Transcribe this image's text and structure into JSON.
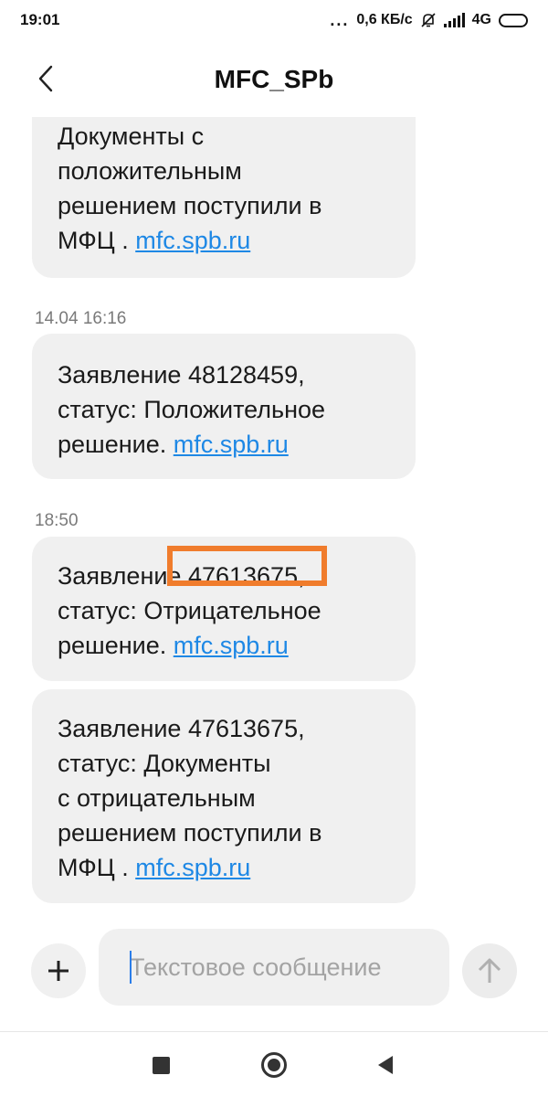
{
  "status_bar": {
    "time": "19:01",
    "dots": "...",
    "speed": "0,6 КБ/с",
    "network": "4G"
  },
  "header": {
    "title": "MFC_SPb"
  },
  "messages": [
    {
      "timestamp": "",
      "lines": [
        "Документы с",
        "положительным",
        "решением поступили в"
      ],
      "tail": "МФЦ . ",
      "link": "mfc.spb.ru"
    },
    {
      "timestamp": "14.04 16:16",
      "lines": [
        "Заявление 48128459,",
        "статус: Положительное"
      ],
      "tail": "решение. ",
      "link": "mfc.spb.ru"
    },
    {
      "timestamp": "18:50",
      "lines": [
        "Заявление 47613675,",
        "статус: Отрицательное"
      ],
      "tail": "решение. ",
      "link": "mfc.spb.ru"
    },
    {
      "timestamp": "",
      "lines": [
        "Заявление 47613675,",
        "статус: Документы",
        "с отрицательным",
        "решением поступили в"
      ],
      "tail": "МФЦ . ",
      "link": "mfc.spb.ru"
    }
  ],
  "composer": {
    "placeholder": "Текстовое сообщение"
  },
  "colors": {
    "bubble": "#f0f0f0",
    "link": "#1e88e5",
    "highlight": "#f07c2c"
  }
}
